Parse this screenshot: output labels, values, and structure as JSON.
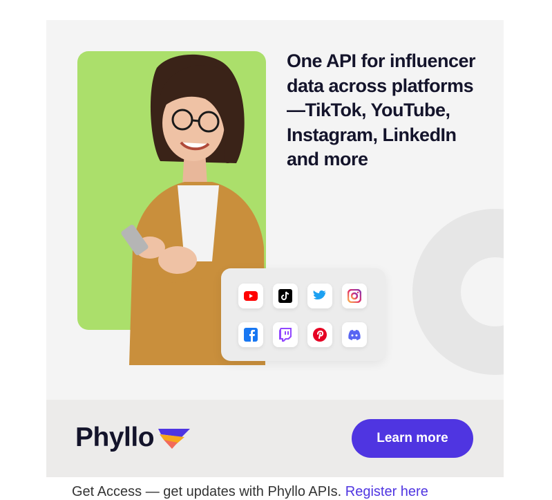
{
  "ad": {
    "headline": "One API for influencer data across platforms—TikTok, YouTube, Instagram, LinkedIn and more",
    "brand_name": "Phyllo",
    "cta_label": "Learn more",
    "platform_icons": [
      "youtube-icon",
      "tiktok-icon",
      "twitter-icon",
      "instagram-icon",
      "facebook-icon",
      "twitch-icon",
      "pinterest-icon",
      "discord-icon"
    ]
  },
  "caption": {
    "text": "Get Access — get updates with Phyllo APIs.",
    "link_label": "Register here"
  },
  "colors": {
    "card_bg": "#f4f4f4",
    "photo_bg": "#abdf6b",
    "headline": "#14142b",
    "cta": "#4f35e1",
    "footer_bg": "#ecebea"
  }
}
